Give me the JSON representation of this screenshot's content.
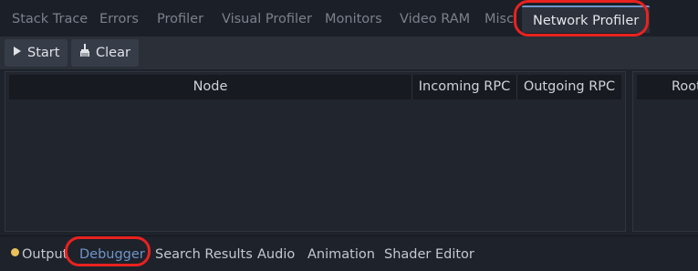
{
  "debugger_tabs": {
    "items": [
      {
        "label": "Stack Trace"
      },
      {
        "label": "Errors"
      },
      {
        "label": "Profiler"
      },
      {
        "label": "Visual Profiler"
      },
      {
        "label": "Monitors"
      },
      {
        "label": "Video RAM"
      },
      {
        "label": "Misc"
      },
      {
        "label": "Network Profiler"
      }
    ],
    "active": "Network Profiler"
  },
  "toolbar": {
    "start_label": "Start",
    "start_icon": "play-icon",
    "clear_label": "Clear",
    "clear_icon": "brush-icon"
  },
  "rpc_table": {
    "columns": [
      "Node",
      "Incoming RPC",
      "Outgoing RPC"
    ],
    "rows": []
  },
  "right_table": {
    "columns": [
      "Root"
    ]
  },
  "bottom_tabs": {
    "items": [
      {
        "label": "Output"
      },
      {
        "label": "Debugger"
      },
      {
        "label": "Search Results"
      },
      {
        "label": "Audio"
      },
      {
        "label": "Animation"
      },
      {
        "label": "Shader Editor"
      }
    ],
    "active": "Debugger"
  },
  "colors": {
    "accent": "#6f95c9",
    "annotation": "#e9221f",
    "output_indicator": "#e8c15a"
  }
}
